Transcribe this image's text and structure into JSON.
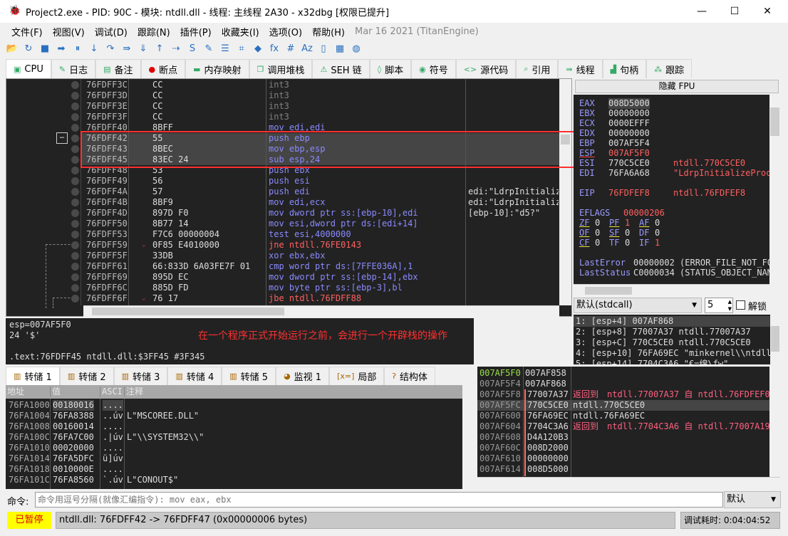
{
  "title": "Project2.exe - PID: 90C - 模块: ntdll.dll - 线程: 主线程 2A30 - x32dbg [权限已提升]",
  "window_controls": [
    "—",
    "☐",
    "✕"
  ],
  "menu": [
    "文件(F)",
    "视图(V)",
    "调试(D)",
    "跟踪(N)",
    "插件(P)",
    "收藏夹(I)",
    "选项(O)",
    "帮助(H)"
  ],
  "version": "Mar 16 2021 (TitanEngine)",
  "toolbar": [
    {
      "icon": "open-icon",
      "g": "📂"
    },
    {
      "icon": "restart-icon",
      "g": "↻"
    },
    {
      "icon": "stop-icon",
      "g": "■"
    },
    {
      "icon": "run-icon",
      "g": "➡"
    },
    {
      "icon": "pause-icon",
      "g": "⏸"
    },
    {
      "icon": "step-into-icon",
      "g": "↓"
    },
    {
      "icon": "step-over-icon",
      "g": "↷"
    },
    {
      "icon": "trace-into-icon",
      "g": "⇛"
    },
    {
      "icon": "trace-over-icon",
      "g": "⇓"
    },
    {
      "icon": "execute-till-return-icon",
      "g": "↑"
    },
    {
      "icon": "run-to-user-code-icon",
      "g": "⇢"
    },
    {
      "icon": "scylla-icon",
      "g": "S"
    },
    {
      "icon": "patch-icon",
      "g": "✎"
    },
    {
      "icon": "comments-icon",
      "g": "☰"
    },
    {
      "icon": "labels-icon",
      "g": "⌗"
    },
    {
      "icon": "bookmarks-icon",
      "g": "◆"
    },
    {
      "icon": "functions-icon",
      "g": "fx"
    },
    {
      "icon": "hash-icon",
      "g": "#"
    },
    {
      "icon": "font-icon",
      "g": "Aᴢ"
    },
    {
      "icon": "device-icon",
      "g": "▯"
    },
    {
      "icon": "calculator-icon",
      "g": "▦"
    },
    {
      "icon": "globe-icon",
      "g": "◍"
    }
  ],
  "tabs": [
    {
      "label": "CPU",
      "icon": "cpu-icon",
      "g": "▣"
    },
    {
      "label": "日志",
      "icon": "log-icon",
      "g": "✎"
    },
    {
      "label": "备注",
      "icon": "notes-icon",
      "g": "▤"
    },
    {
      "label": "断点",
      "icon": "breakpoint-icon",
      "g": "●"
    },
    {
      "label": "内存映射",
      "icon": "memory-icon",
      "g": "▬"
    },
    {
      "label": "调用堆栈",
      "icon": "callstack-icon",
      "g": "❐"
    },
    {
      "label": "SEH 链",
      "icon": "seh-icon",
      "g": "⚠"
    },
    {
      "label": "脚本",
      "icon": "script-icon",
      "g": "◊"
    },
    {
      "label": "符号",
      "icon": "symbols-icon",
      "g": "◉"
    },
    {
      "label": "源代码",
      "icon": "source-icon",
      "g": "<>"
    },
    {
      "label": "引用",
      "icon": "references-icon",
      "g": "⌕"
    },
    {
      "label": "线程",
      "icon": "threads-icon",
      "g": "⇛"
    },
    {
      "label": "句柄",
      "icon": "handles-icon",
      "g": "▟"
    },
    {
      "label": "跟踪",
      "icon": "trace-icon",
      "g": "⁂"
    }
  ],
  "disasm": [
    {
      "addr": "76FDFF3C",
      "bytes": "CC",
      "ins": "int3",
      "cmt": ""
    },
    {
      "addr": "76FDFF3D",
      "bytes": "CC",
      "ins": "int3",
      "cmt": ""
    },
    {
      "addr": "76FDFF3E",
      "bytes": "CC",
      "ins": "int3",
      "cmt": ""
    },
    {
      "addr": "76FDFF3F",
      "bytes": "CC",
      "ins": "int3",
      "cmt": ""
    },
    {
      "addr": "76FDFF40",
      "bytes": "8BFF",
      "ins": "mov edi,edi",
      "cmt": ""
    },
    {
      "addr": "76FDFF42",
      "bytes": "55",
      "ins": "push ebp",
      "cmt": "",
      "sel": true
    },
    {
      "addr": "76FDFF43",
      "bytes": "8BEC",
      "ins": "mov ebp,esp",
      "cmt": "",
      "sel": true
    },
    {
      "addr": "76FDFF45",
      "bytes": "83EC 24",
      "ins": "sub esp,24",
      "cmt": "",
      "sel": true
    },
    {
      "addr": "76FDFF48",
      "bytes": "53",
      "ins": "push ebx",
      "cmt": ""
    },
    {
      "addr": "76FDFF49",
      "bytes": "56",
      "ins": "push esi",
      "cmt": ""
    },
    {
      "addr": "76FDFF4A",
      "bytes": "57",
      "ins": "push edi",
      "cmt": "edi:\"LdrpInitialize"
    },
    {
      "addr": "76FDFF4B",
      "bytes": "8BF9",
      "ins": "mov edi,ecx",
      "cmt": "edi:\"LdrpInitialize"
    },
    {
      "addr": "76FDFF4D",
      "bytes": "897D F0",
      "ins": "mov dword ptr ss:[ebp-10],edi",
      "cmt": "[ebp-10]:\"d5?\""
    },
    {
      "addr": "76FDFF50",
      "bytes": "8B77 14",
      "ins": "mov esi,dword ptr ds:[edi+14]",
      "cmt": ""
    },
    {
      "addr": "76FDFF53",
      "bytes": "F7C6 00000004",
      "ins": "test esi,4000000",
      "cmt": ""
    },
    {
      "addr": "76FDFF59",
      "bytes": "0F85 E4010000",
      "ins": "jne ntdll.76FE0143",
      "cmt": "",
      "jmp": true
    },
    {
      "addr": "76FDFF5F",
      "bytes": "33DB",
      "ins": "xor ebx,ebx",
      "cmt": ""
    },
    {
      "addr": "76FDFF61",
      "bytes": "66:833D 6A03FE7F 01",
      "ins": "cmp word ptr ds:[7FFE036A],1",
      "cmt": ""
    },
    {
      "addr": "76FDFF69",
      "bytes": "895D EC",
      "ins": "mov dword ptr ss:[ebp-14],ebx",
      "cmt": ""
    },
    {
      "addr": "76FDFF6C",
      "bytes": "885D FD",
      "ins": "mov byte ptr ss:[ebp-3],bl",
      "cmt": ""
    },
    {
      "addr": "76FDFF6F",
      "bytes": "76 17",
      "ins": "jbe ntdll.76FDFF88",
      "cmt": "",
      "jmp": true
    }
  ],
  "regs": {
    "hide_fpu": "隐藏 FPU",
    "general": [
      {
        "n": "EAX",
        "v": "008D5000",
        "c": ""
      },
      {
        "n": "EBX",
        "v": "00000000",
        "c": ""
      },
      {
        "n": "ECX",
        "v": "0000EFFF",
        "c": ""
      },
      {
        "n": "EDX",
        "v": "00000000",
        "c": ""
      },
      {
        "n": "EBP",
        "v": "007AF5F4",
        "c": ""
      },
      {
        "n": "ESP",
        "v": "007AF5F0",
        "c": "",
        "chg": true
      },
      {
        "n": "ESI",
        "v": "770C5CE0",
        "c": "ntdll.770C5CE0"
      },
      {
        "n": "EDI",
        "v": "76FA6A68",
        "c": "\"LdrpInitializeProce"
      }
    ],
    "eip": {
      "n": "EIP",
      "v": "76FDFEF8",
      "c": "ntdll.76FDFEF8"
    },
    "eflags": {
      "n": "EFLAGS",
      "v": "00000206"
    },
    "flags": [
      [
        "ZF",
        "0"
      ],
      [
        "PF",
        "1"
      ],
      [
        "AF",
        "0"
      ],
      [
        "OF",
        "0"
      ],
      [
        "SF",
        "0"
      ],
      [
        "DF",
        "0"
      ],
      [
        "CF",
        "0"
      ],
      [
        "TF",
        "0"
      ],
      [
        "IF",
        "1"
      ]
    ],
    "lasterror": {
      "n": "LastError",
      "v": "00000002 (ERROR_FILE_NOT_FOU"
    },
    "laststatus": {
      "n": "LastStatus",
      "v": "C0000034 (STATUS_OBJECT_NAME"
    },
    "callconv": "默认(stdcall)",
    "argcount": "5",
    "unlock": "解锁",
    "args": [
      "1: [esp+4] 007AF868",
      "2: [esp+8] 77007A37 ntdll.77007A37",
      "3: [esp+C] 770C5CE0 ntdll.770C5CE0",
      "4: [esp+10] 76FA69EC \"minkernel\\\\ntdll\\",
      "5: [esp+14] 7704C3A6 \"€=绵\\fw\""
    ]
  },
  "info": {
    "line1": "esp=007AF5F0",
    "line2": "24 '$'",
    "line3": ".text:76FDFF45 ntdll.dll:$3FF45 #3F345",
    "annotation": "在一个程序正式开始运行之前，会进行一个开辟栈的操作"
  },
  "dump_tabs": [
    {
      "label": "转储 1",
      "g": "▥"
    },
    {
      "label": "转储 2",
      "g": "▥"
    },
    {
      "label": "转储 3",
      "g": "▥"
    },
    {
      "label": "转储 4",
      "g": "▥"
    },
    {
      "label": "转储 5",
      "g": "▥"
    },
    {
      "label": "监视 1",
      "g": "◕"
    },
    {
      "label": "局部",
      "g": "[x=]"
    },
    {
      "label": "结构体",
      "g": "ʔ"
    }
  ],
  "dump_headers": [
    "地址",
    "值",
    "ASCI",
    "注释"
  ],
  "dump": [
    [
      "76FA1000",
      "00180016",
      "....",
      ""
    ],
    [
      "76FA1004",
      "76FA8388",
      "..úv",
      "L\"MSCOREE.DLL\""
    ],
    [
      "76FA1008",
      "00160014",
      "....",
      ""
    ],
    [
      "76FA100C",
      "76FA7C00",
      ".|úv",
      "L\"\\\\SYSTEM32\\\\\""
    ],
    [
      "76FA1010",
      "00020000",
      "....",
      ""
    ],
    [
      "76FA1014",
      "76FA5DFC",
      "ü]úv",
      ""
    ],
    [
      "76FA1018",
      "0010000E",
      "....",
      ""
    ],
    [
      "76FA101C",
      "76FA8560",
      "`.úv",
      "L\"CONOUT$\""
    ]
  ],
  "stack": [
    [
      "007AF5F0",
      "007AF858",
      "",
      ""
    ],
    [
      "007AF5F4",
      "007AF868",
      "",
      ""
    ],
    [
      "007AF5F8",
      "77007A37",
      "返回到",
      "ntdll.77007A37 自 ntdll.76FDFEF0"
    ],
    [
      "007AF5FC",
      "770C5CE0",
      "",
      "ntdll.770C5CE0"
    ],
    [
      "007AF600",
      "76FA69EC",
      "",
      "ntdll.76FA69EC"
    ],
    [
      "007AF604",
      "7704C3A6",
      "返回到",
      "ntdll.7704C3A6 自 ntdll.77007A19"
    ],
    [
      "007AF608",
      "D4A120B3",
      "",
      ""
    ],
    [
      "007AF60C",
      "008D2000",
      "",
      ""
    ],
    [
      "007AF610",
      "00000000",
      "",
      ""
    ],
    [
      "007AF614",
      "008D5000",
      "",
      ""
    ]
  ],
  "command": {
    "label": "命令:",
    "placeholder": "命令用逗号分隔(就像汇编指令): mov eax, ebx",
    "mode": "默认"
  },
  "status": {
    "state": "已暂停",
    "message": "ntdll.dll: 76FDFF42 -> 76FDFF47 (0x00000006 bytes)",
    "timer": "调试耗时: 0:04:04:52"
  },
  "colors": {
    "accent_red": "#ff3030",
    "paused_bg": "#ffff00",
    "mnemonic": "#8a8aff",
    "number": "#ff6060"
  }
}
